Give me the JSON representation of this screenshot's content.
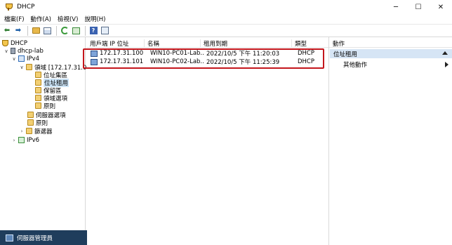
{
  "window": {
    "title": "DHCP",
    "minimize": "─",
    "maximize": "☐",
    "close": "✕"
  },
  "menu": [
    "檔案(F)",
    "動作(A)",
    "檢視(V)",
    "說明(H)"
  ],
  "toolbar": {
    "icons": [
      "back-arrow-icon",
      "forward-arrow-icon",
      "folder-up-icon",
      "show-hide-console-tree-icon",
      "refresh-icon",
      "export-list-icon",
      "help-icon",
      "properties-icon"
    ]
  },
  "tree": {
    "root": "DHCP",
    "server": "dhcp-lab",
    "ipv4": "IPv4",
    "scope": "領域 [172.17.31.0",
    "address_pool": "位址集區",
    "address_leases": "位址租用",
    "reservations": "保留區",
    "scope_options": "領域選項",
    "scope_policies": "原則",
    "server_options": "伺服器選項",
    "policies": "原則",
    "filters": "篩選器",
    "ipv6": "IPv6"
  },
  "status": {
    "label": "伺服器管理員"
  },
  "list": {
    "columns": [
      "用戶端 IP 位址",
      "名稱",
      "租用到期",
      "類型"
    ],
    "rows": [
      {
        "ip": "172.17.31.100",
        "name": "WIN10-PC01-Lab...",
        "expires": "2022/10/5 下午 11:20:03",
        "type": "DHCP"
      },
      {
        "ip": "172.17.31.101",
        "name": "WIN10-PC02-Lab...",
        "expires": "2022/10/5 下午 11:25:39",
        "type": "DHCP"
      }
    ]
  },
  "actions": {
    "header": "動作",
    "section": "位址租用",
    "more": "其他動作"
  },
  "colors": {
    "highlight_border": "#c4161c",
    "selection": "#cce4f7",
    "actions_section": "#d6e5f5",
    "statusbar": "#1f3d5c"
  }
}
